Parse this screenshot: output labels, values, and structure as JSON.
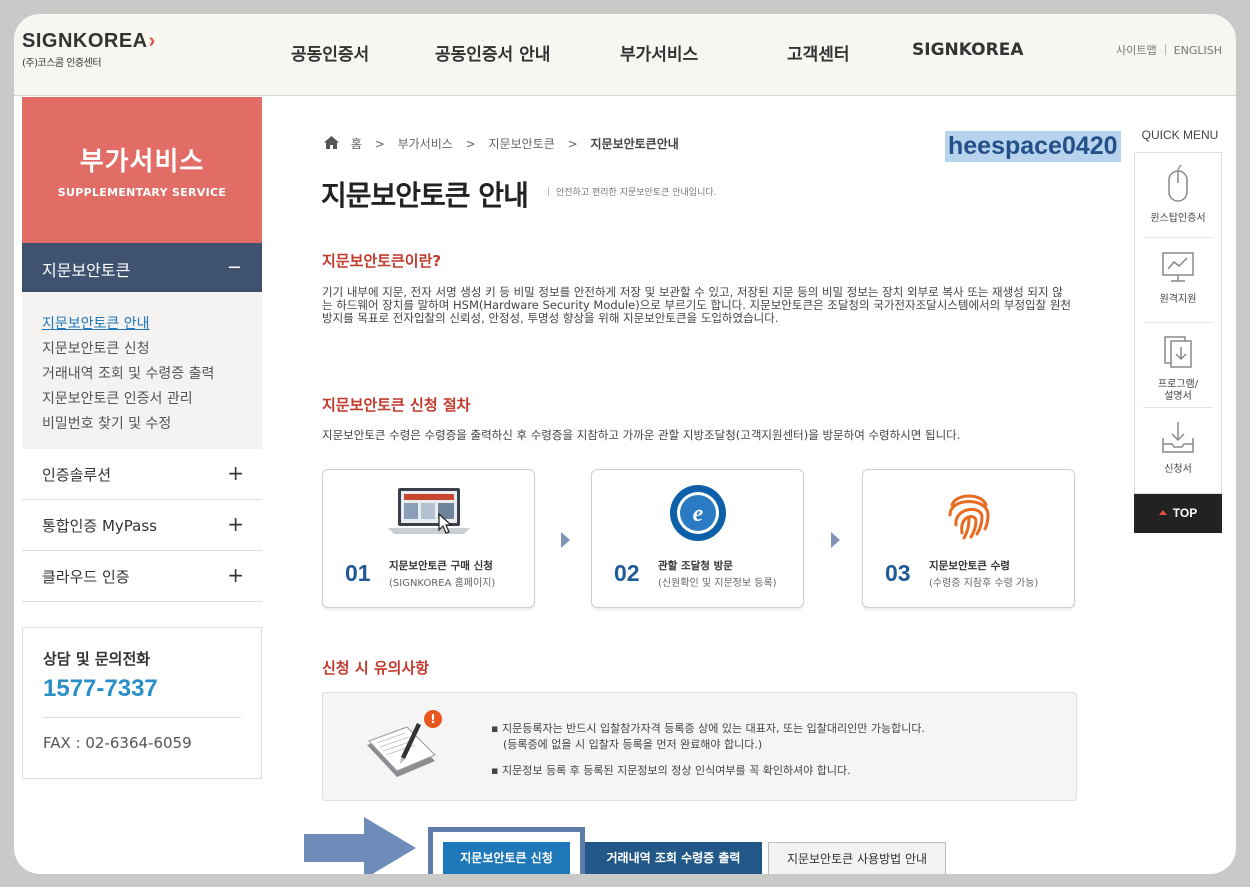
{
  "header": {
    "logo_main": "SIGNKOREA",
    "logo_sub": "(주)코스콤 인증센터",
    "nav": [
      "공동인증서",
      "공동인증서 안내",
      "부가서비스",
      "고객센터",
      "SIGNKOREA"
    ],
    "sitemap": "사이트맵",
    "english": "ENGLISH"
  },
  "sidebar": {
    "title": "부가서비스",
    "subtitle": "SUPPLEMENTARY SERVICE",
    "active_menu": "지문보안토큰",
    "active_icon": "−",
    "sub_items": [
      "지문보안토큰 안내",
      "지문보안토큰 신청",
      "거래내역 조회 및 수령증 출력",
      "지문보안토큰 인증서 관리",
      "비밀번호 찾기 및 수정"
    ],
    "menus": [
      "인증솔루션",
      "통합인증 MyPass",
      "클라우드 인증"
    ],
    "expand_icon": "+",
    "contact_title": "상담 및 문의전화",
    "contact_phone": "1577-7337",
    "contact_fax": "FAX : 02-6364-6059"
  },
  "breadcrumb": {
    "home_icon": "home-icon",
    "home": "홈",
    "sep": ">",
    "level1": "부가서비스",
    "level2": "지문보안토큰",
    "current": "지문보안토큰안내"
  },
  "user_id": "heespace0420",
  "page": {
    "title": "지문보안토큰 안내",
    "desc": "안전하고 편리한 지문보안토큰 안내입니다."
  },
  "section1": {
    "title": "지문보안토큰이란?",
    "text": "기기 내부에 지문, 전자 서명 생성 키 등 비밀 정보를 안전하게 저장 및 보관할 수 있고, 저장된 지문 등의 비밀 정보는 장치 외부로 복사 또는 재생성 되지 않는 하드웨어 장치를 말하며 HSM(Hardware Security Module)으로 부르기도 합니다. 지문보안토큰은 조달청의 국가전자조달시스템에서의 부정입찰 원천방지를 목표로 전자입찰의 신뢰성, 안정성, 투명성 향상을 위해 지문보안토큰을 도입하였습니다."
  },
  "section2": {
    "title": "지문보안토큰 신청 절차",
    "text": "지문보안토큰 수령은 수령증을 출력하신 후 수령증을 지참하고 가까운 관할 지방조달청(고객지원센터)을 방문하여 수령하시면 됩니다.",
    "steps": [
      {
        "no": "01",
        "name": "지문보안토큰 구매 신청",
        "desc": "(SIGNKOREA 홈페이지)",
        "icon": "laptop-icon"
      },
      {
        "no": "02",
        "name": "관할 조달청 방문",
        "desc": "(신원확인 및 지문정보 등록)",
        "icon": "procurement-seal-icon",
        "seal_text": "e"
      },
      {
        "no": "03",
        "name": "지문보안토큰 수령",
        "desc": "(수령증 지참후 수령 가능)",
        "icon": "fingerprint-icon"
      }
    ]
  },
  "section3": {
    "title": "신청 시 유의사항",
    "items": [
      {
        "line1": "지문등록자는 반드시 입찰참가자격 등록증 상에 있는 대표자, 또는 입찰대리인만 가능합니다.",
        "line2": "(등록증에 없을 시 입찰자 등록을 먼저 완료해야 합니다.)"
      },
      {
        "line1": "지문정보 등록 후 등록된 지문정보의 정상 인식여부를 꼭 확인하셔야 합니다.",
        "line2": ""
      }
    ],
    "bullet": "▪",
    "badge": "!"
  },
  "buttons": {
    "apply": "지문보안토큰 신청",
    "receipt": "거래내역 조회 수령증 출력",
    "guide": "지문보안토큰 사용방법 안내"
  },
  "quick_menu": {
    "title": "QUICK MENU",
    "items": [
      {
        "label": "윈스탑인증서",
        "icon": "mouse-icon"
      },
      {
        "label": "원격지원",
        "icon": "monitor-chart-icon"
      },
      {
        "label": "프로그램/\n설명서",
        "icon": "document-download-icon"
      },
      {
        "label": "신청서",
        "icon": "tray-download-icon"
      }
    ],
    "top": "TOP"
  },
  "colors": {
    "accent_red": "#e26d66",
    "nav_dark": "#3f5270",
    "link_blue": "#2277bb",
    "section_red": "#c2392d",
    "button_blue": "#1f78b9",
    "button_navy": "#225887"
  }
}
